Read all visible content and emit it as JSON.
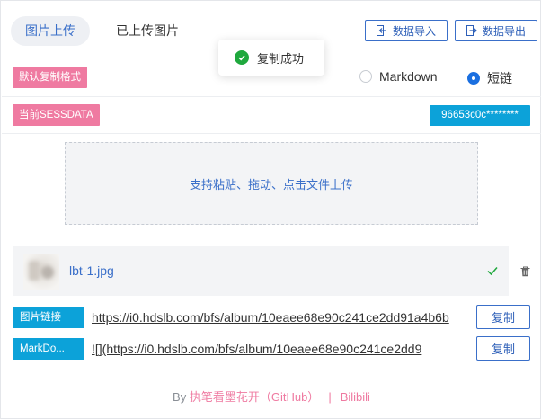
{
  "header": {
    "tabs": [
      {
        "label": "图片上传",
        "active": true
      },
      {
        "label": "已上传图片",
        "active": false
      }
    ],
    "import_label": "数据导入",
    "export_label": "数据导出"
  },
  "toast": {
    "text": "复制成功",
    "icon": "check-circle-icon",
    "color": "#1fa83d"
  },
  "format": {
    "label": "默认复制格式",
    "options": [
      {
        "label": "Markdown",
        "selected": false
      },
      {
        "label": "短链",
        "selected": true
      }
    ]
  },
  "sessdata": {
    "label": "当前SESSDATA",
    "value": "96653c0c********"
  },
  "dropzone": {
    "text": "支持粘贴、拖动、点击文件上传"
  },
  "file": {
    "name": "lbt-1.jpg",
    "status": "uploaded"
  },
  "links": [
    {
      "label": "图片链接",
      "value": "https://i0.hdslb.com/bfs/album/10eaee68e90c241ce2dd91a4b6b",
      "copy_label": "复制"
    },
    {
      "label": "MarkDo...",
      "value": "![](https://i0.hdslb.com/bfs/album/10eaee68e90c241ce2dd9",
      "copy_label": "复制"
    }
  ],
  "footer": {
    "prefix": "By ",
    "author": "执笔看墨花开（GitHub）",
    "separator": "|",
    "site": "Bilibili"
  },
  "colors": {
    "accent": "#3a6fc9",
    "pink": "#ef7aa1",
    "cyan": "#0ca2d9",
    "success": "#1fa83d"
  }
}
